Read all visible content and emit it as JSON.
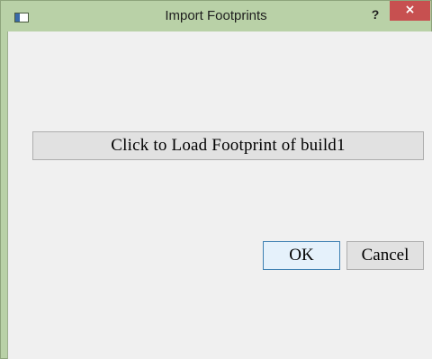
{
  "window": {
    "title": "Import Footprints",
    "help_label": "?",
    "close_label": "×"
  },
  "dialog": {
    "load_button_label": "Click to Load Footprint of build1",
    "ok_label": "OK",
    "cancel_label": "Cancel"
  },
  "icons": {
    "app": "window-icon",
    "help": "help-icon",
    "close": "close-icon"
  },
  "colors": {
    "frame": "#b9d1a7",
    "client": "#f0f0f0",
    "close_button": "#c75050",
    "button_face": "#e1e1e1",
    "default_button_border": "#3c7fb1"
  }
}
